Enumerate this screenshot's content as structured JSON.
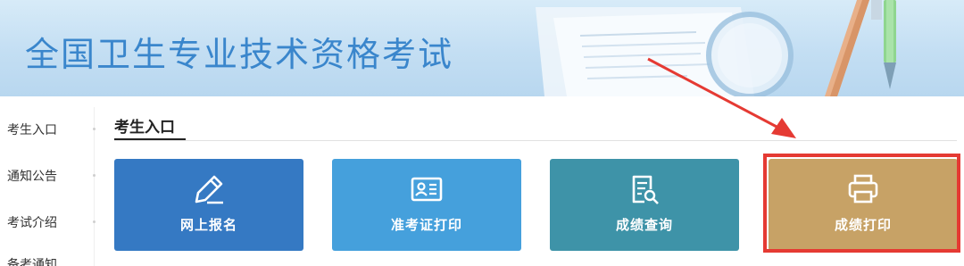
{
  "banner": {
    "title": "全国卫生专业技术资格考试"
  },
  "sidebar": {
    "items": [
      {
        "label": "考生入口"
      },
      {
        "label": "通知公告"
      },
      {
        "label": "考试介绍"
      },
      {
        "label": "备考通知"
      }
    ]
  },
  "section": {
    "title": "考生入口"
  },
  "cards": [
    {
      "label": "网上报名",
      "icon": "pencil-icon",
      "color": "#3579c3"
    },
    {
      "label": "准考证打印",
      "icon": "id-card-icon",
      "color": "#45a0dc"
    },
    {
      "label": "成绩查询",
      "icon": "document-search-icon",
      "color": "#3e93a8"
    },
    {
      "label": "成绩打印",
      "icon": "printer-icon",
      "color": "#c7a266"
    }
  ],
  "colors": {
    "accent_title": "#3a86cc",
    "highlight": "#e53a33"
  }
}
